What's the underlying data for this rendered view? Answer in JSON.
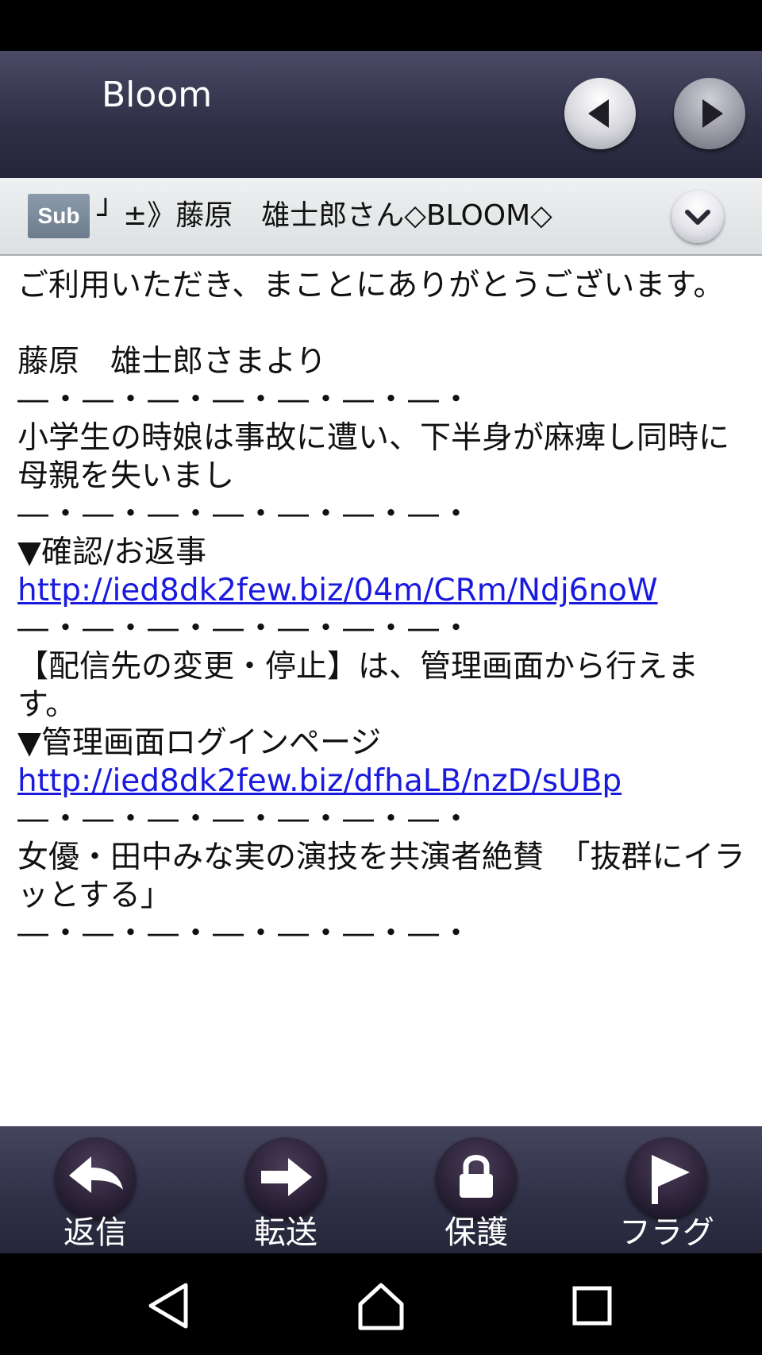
{
  "app": {
    "title": "Bloom"
  },
  "subject": {
    "badge": "Sub",
    "text": "┘ ±》藤原　雄士郎さん◇BLOOM◇"
  },
  "body": {
    "lines": [
      {
        "type": "text",
        "text": "ご利用いただき、まことにありがとうございます。"
      },
      {
        "type": "blank",
        "text": ""
      },
      {
        "type": "text",
        "text": "藤原　雄士郎さまより"
      },
      {
        "type": "sep",
        "text": "―・―・―・―・―・―・―・"
      },
      {
        "type": "text",
        "text": "小学生の時娘は事故に遭い、下半身が麻痺し同時に母親を失いまし"
      },
      {
        "type": "sep",
        "text": "―・―・―・―・―・―・―・"
      },
      {
        "type": "text",
        "text": "▼確認/お返事"
      },
      {
        "type": "link",
        "text": "http://ied8dk2few.biz/04m/CRm/Ndj6noW"
      },
      {
        "type": "sep",
        "text": "―・―・―・―・―・―・―・"
      },
      {
        "type": "text",
        "text": "【配信先の変更・停止】は、管理画面から行えます。"
      },
      {
        "type": "text",
        "text": "▼管理画面ログインページ"
      },
      {
        "type": "link",
        "text": "http://ied8dk2few.biz/dfhaLB/nzD/sUBp"
      },
      {
        "type": "sep",
        "text": "―・―・―・―・―・―・―・"
      },
      {
        "type": "text",
        "text": "女優・田中みな実の演技を共演者絶賛　「抜群にイラッとする」"
      },
      {
        "type": "sep",
        "text": "―・―・―・―・―・―・―・"
      }
    ]
  },
  "actions": [
    {
      "label": "返信",
      "icon": "reply-arrow-icon"
    },
    {
      "label": "転送",
      "icon": "forward-arrow-icon"
    },
    {
      "label": "保護",
      "icon": "lock-icon"
    },
    {
      "label": "フラグ",
      "icon": "flag-icon"
    }
  ],
  "colors": {
    "header": "#2e2e45",
    "link": "#1a1adf",
    "badge": "#7b8b9b"
  }
}
